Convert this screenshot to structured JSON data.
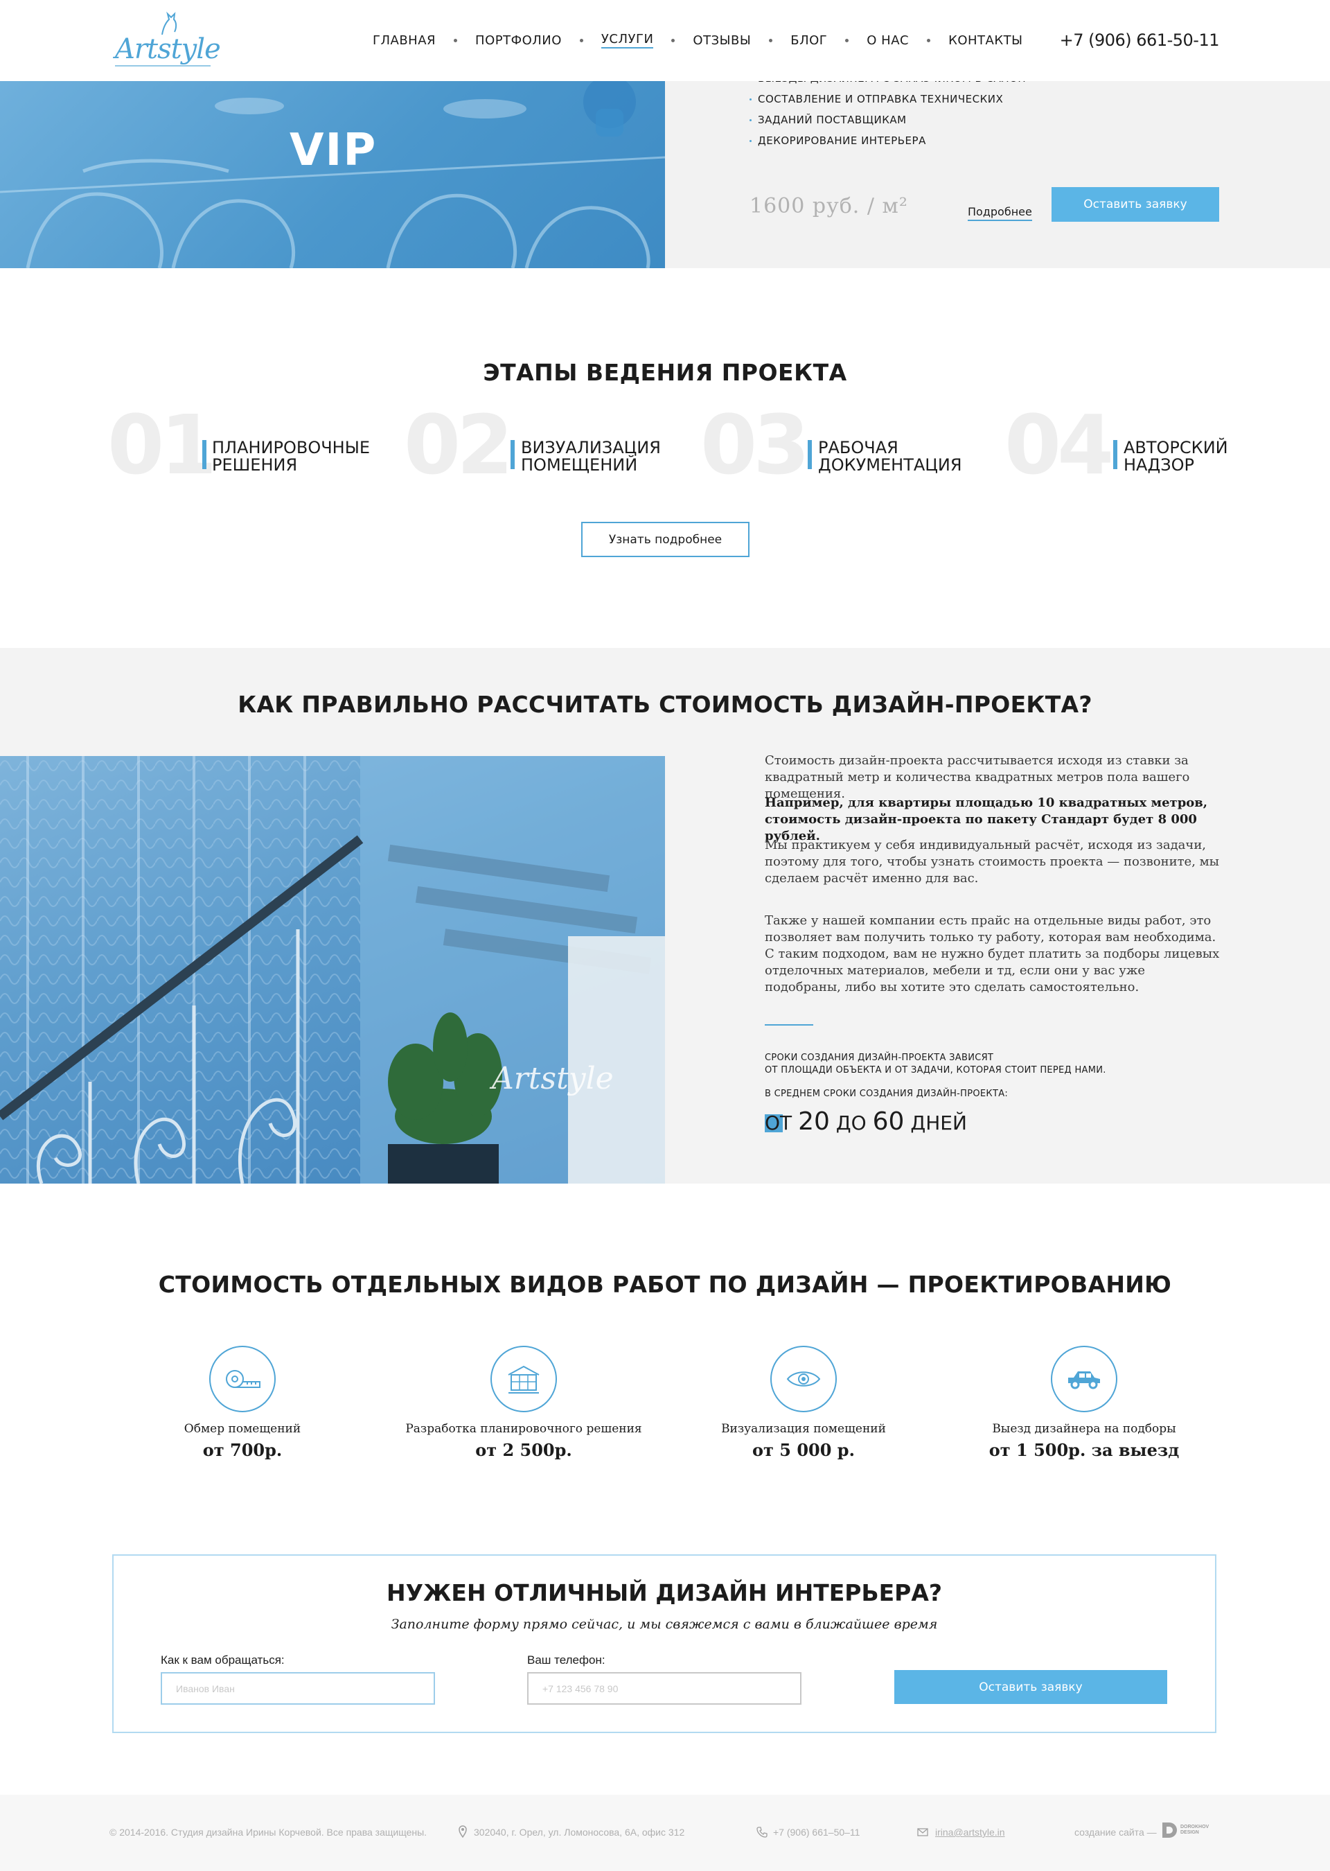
{
  "header": {
    "logo_text": "Artstyle",
    "nav": [
      "ГЛАВНАЯ",
      "ПОРТФОЛИО",
      "УСЛУГИ",
      "ОТЗЫВЫ",
      "БЛОГ",
      "О НАС",
      "КОНТАКТЫ"
    ],
    "active_nav": "УСЛУГИ",
    "phone": "+7 (906) 661-50-11"
  },
  "vip": {
    "title": "VIP",
    "list": [
      "ВЫЕЗДЫ ДИЗАЙНЕРА С ЗАКАЗЧИКОМ В САЛОН",
      "СОСТАВЛЕНИЕ И ОТПРАВКА ТЕХНИЧЕСКИХ",
      "ЗАДАНИЙ ПОСТАВЩИКАМ",
      "ДЕКОРИРОВАНИЕ ИНТЕРЬЕРА"
    ],
    "price": "1600 руб. / м²",
    "more_label": "Подробнее",
    "order_label": "Оставить заявку"
  },
  "stages": {
    "title": "ЭТАПЫ ВЕДЕНИЯ ПРОЕКТА",
    "items": [
      {
        "num": "01",
        "line1": "ПЛАНИРОВОЧНЫЕ",
        "line2": "РЕШЕНИЯ"
      },
      {
        "num": "02",
        "line1": "ВИЗУАЛИЗАЦИЯ",
        "line2": "ПОМЕЩЕНИЙ"
      },
      {
        "num": "03",
        "line1": "РАБОЧАЯ",
        "line2": "ДОКУМЕНТАЦИЯ"
      },
      {
        "num": "04",
        "line1": "АВТОРСКИЙ",
        "line2": "НАДЗОР"
      }
    ],
    "more_label": "Узнать подробнее"
  },
  "calc": {
    "title": "КАК ПРАВИЛЬНО РАССЧИТАТЬ СТОИМОСТЬ ДИЗАЙН-ПРОЕКТА?",
    "watermark": "Artstyle",
    "p1": "Стоимость дизайн-проекта рассчитывается исходя из ставки за квадратный метр и количества квадратных метров пола вашего помещения.",
    "p2": "Например, для квартиры площадью 10 квадратных метров, стоимость дизайн-проекта по пакету Стандарт будет 8 000 рублей.",
    "p3": "Мы практикуем у себя индивидуальный расчёт, исходя из задачи, поэтому для того, чтобы узнать стоимость проекта — позвоните, мы сделаем расчёт именно для вас.",
    "p4": "Также у нашей компании есть прайс на отдельные виды работ, это позволяет вам получить только ту работу, которая вам необходима. С таким подходом, вам не нужно будет платить за подборы лицевых отделочных материалов, мебели и тд, если они у вас уже подобраны, либо вы хотите это сделать самостоятельно.",
    "caps1": "СРОКИ СОЗДАНИЯ ДИЗАЙН-ПРОЕКТА ЗАВИСЯТ",
    "caps2": "ОТ ПЛОЩАДИ ОБЪЕКТА И ОТ ЗАДАЧИ, КОТОРАЯ СТОИТ ПЕРЕД НАМИ.",
    "caps3": "В СРЕДНЕМ СРОКИ СОЗДАНИЯ ДИЗАЙН-ПРОЕКТА:",
    "days_from": "ОТ",
    "days_min": "20",
    "days_to": "ДО",
    "days_max": "60",
    "days_unit": "ДНЕЙ"
  },
  "prices": {
    "title": "СТОИМОСТЬ ОТДЕЛЬНЫХ ВИДОВ РАБОТ ПО ДИЗАЙН — ПРОЕКТИРОВАНИЮ",
    "items": [
      {
        "icon": "tape-measure-icon",
        "label": "Обмер помещений",
        "value": "от 700р."
      },
      {
        "icon": "floor-plan-icon",
        "label": "Разработка планировочного решения",
        "value": "от 2 500р."
      },
      {
        "icon": "eye-icon",
        "label": "Визуализация помещений",
        "value": "от 5 000 р."
      },
      {
        "icon": "car-icon",
        "label": "Выезд дизайнера на подборы",
        "value": "от 1 500р. за выезд"
      }
    ]
  },
  "form": {
    "title": "НУЖЕН ОТЛИЧНЫЙ ДИЗАЙН ИНТЕРЬЕРА?",
    "subtitle": "Заполните форму прямо сейчас, и мы свяжемся с вами в ближайшее время",
    "name_label": "Как к вам обращаться:",
    "name_placeholder": "Иванов Иван",
    "phone_label": "Ваш телефон:",
    "phone_placeholder": "+7 123 456 78 90",
    "submit_label": "Оставить заявку"
  },
  "footer": {
    "copyright": "© 2014-2016. Студия дизайна Ирины Корчевой. Все права защищены.",
    "address": "302040, г. Орел, ул. Ломоносова, 6А, офис 312",
    "phone": "+7 (906) 661–50–11",
    "email": "irina@artstyle.in",
    "credit": "создание сайта —",
    "credit_logo": "DOROKHOV DESIGN"
  },
  "colors": {
    "accent": "#4fa5d6",
    "button": "#5bb5e6",
    "panel": "#f2f2f2"
  }
}
